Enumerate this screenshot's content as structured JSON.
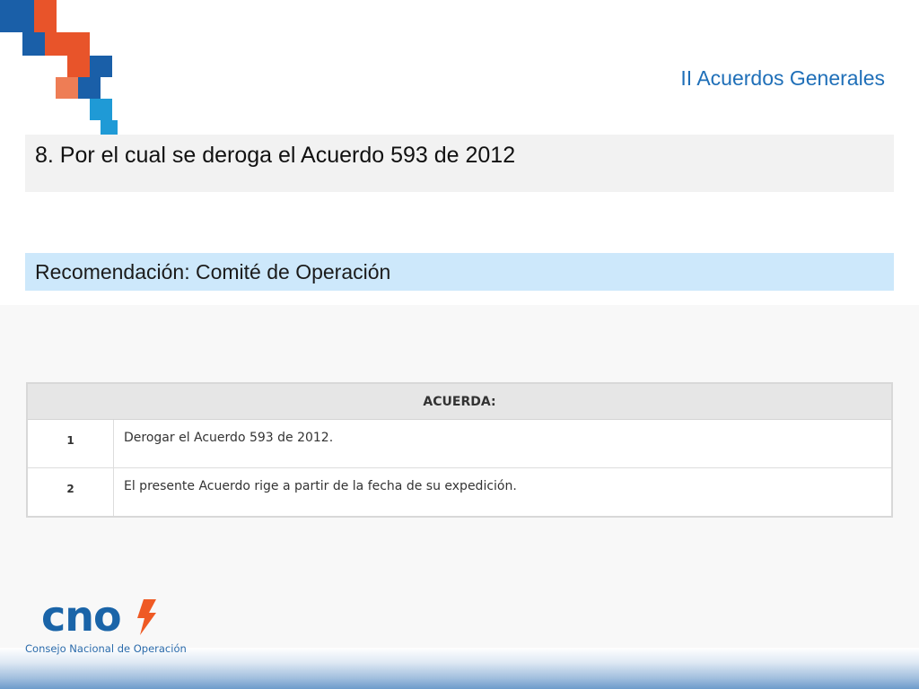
{
  "header": {
    "section_title": "II Acuerdos Generales"
  },
  "agreement": {
    "title": "8. Por el cual se deroga el Acuerdo 593 de 2012",
    "recommendation": "Recomendación: Comité de Operación"
  },
  "acuerda_table": {
    "header": "ACUERDA:",
    "rows": [
      {
        "number": "1",
        "text": "Derogar el Acuerdo 593 de 2012."
      },
      {
        "number": "2",
        "text": "El presente Acuerdo rige a partir de la fecha de su expedición."
      }
    ]
  },
  "logo": {
    "wordmark": "cno",
    "subtitle": "Consejo Nacional de Operación"
  },
  "colors": {
    "deco_dark_blue": "#1a5fa8",
    "deco_orange_red": "#e8542a",
    "deco_light_orange": "#ee7d55",
    "deco_light_blue": "#1f9ad6",
    "title_text_blue": "#1f6fb8",
    "recommendation_bg": "#cde8fb",
    "logo_blue": "#1a64a8",
    "logo_bolt_orange": "#ef5a24"
  }
}
